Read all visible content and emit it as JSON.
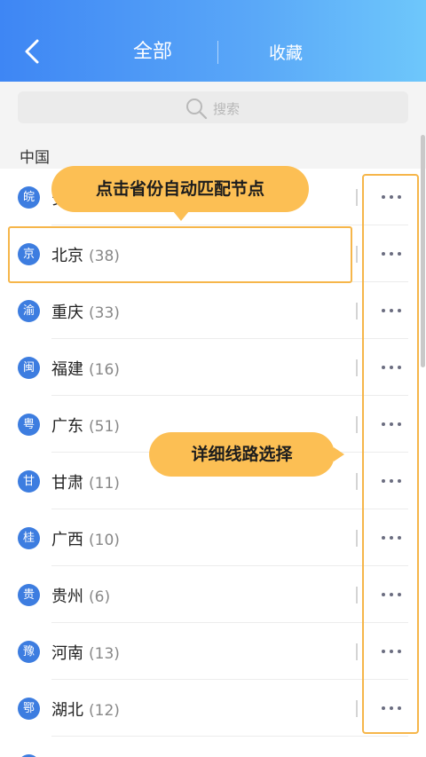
{
  "header": {
    "tab_all": "全部",
    "tab_favorites": "收藏"
  },
  "search": {
    "placeholder": "搜索"
  },
  "section": {
    "title": "中国"
  },
  "provinces": [
    {
      "badge": "皖",
      "name": "安徽",
      "count": ""
    },
    {
      "badge": "京",
      "name": "北京",
      "count": "(38)"
    },
    {
      "badge": "渝",
      "name": "重庆",
      "count": "(33)"
    },
    {
      "badge": "闽",
      "name": "福建",
      "count": "(16)"
    },
    {
      "badge": "粤",
      "name": "广东",
      "count": "(51)"
    },
    {
      "badge": "甘",
      "name": "甘肃",
      "count": "(11)"
    },
    {
      "badge": "桂",
      "name": "广西",
      "count": "(10)"
    },
    {
      "badge": "贵",
      "name": "贵州",
      "count": "(6)"
    },
    {
      "badge": "豫",
      "name": "河南",
      "count": "(13)"
    },
    {
      "badge": "鄂",
      "name": "湖北",
      "count": "(12)"
    }
  ],
  "tips": {
    "auto_match": "点击省份自动匹配节点",
    "route_select": "详细线路选择"
  },
  "colors": {
    "header_start": "#3e86f4",
    "header_end": "#6ec7fb",
    "badge": "#3d7de0",
    "tip": "#fcbf54",
    "highlight_border": "#f6b64a"
  }
}
